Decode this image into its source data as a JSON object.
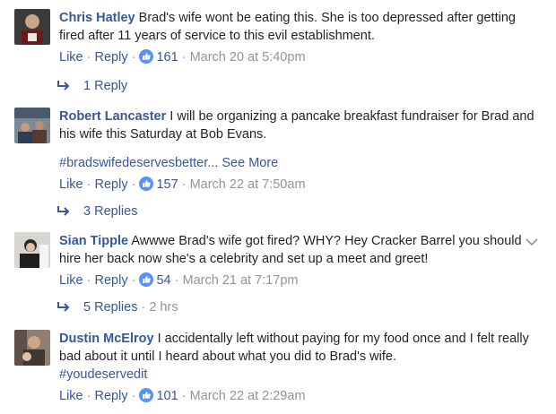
{
  "comments": [
    {
      "name": "Chris Hatley",
      "text": "Brad's wife wont be eating this. She is too depressed after getting fired after 11 years of service to this evil establishment.",
      "hashtag": "",
      "like_label": "Like",
      "reply_label": "Reply",
      "reactions": "161",
      "time": "March 20 at 5:40pm",
      "replies": "1 Reply",
      "replies_age": ""
    },
    {
      "name": "Robert Lancaster",
      "text": "I will be organizing a pancake breakfast fundraiser for Brad and his wife this Saturday at Bob Evans.",
      "hashtag": "#bradswifedeservesbetter...",
      "see_more": "See More",
      "like_label": "Like",
      "reply_label": "Reply",
      "reactions": "157",
      "time": "March 22 at 7:50am",
      "replies": "3 Replies",
      "replies_age": ""
    },
    {
      "name": "Sian Tipple",
      "text": "Awwwe Brad's wife got fired? WHY? Hey Cracker Barrel you should hire her back now she's a celebrity and set up a meet and greet!",
      "hashtag": "",
      "like_label": "Like",
      "reply_label": "Reply",
      "reactions": "54",
      "time": "March 21 at 7:17pm",
      "replies": "5 Replies",
      "replies_age": "2 hrs"
    },
    {
      "name": "Dustin McElroy",
      "text": "I accidentally left without paying for my food once and I felt really bad about it until I heard about what you did to Brad's wife.",
      "hashtag": "#youdeservedit",
      "like_label": "Like",
      "reply_label": "Reply",
      "reactions": "101",
      "time": "March 22 at 2:29am",
      "replies": "",
      "replies_age": ""
    }
  ],
  "icons": {
    "like": "thumbs-up-icon",
    "reply_arrow": "reply-arrow-icon",
    "options": "chevron-down-icon"
  },
  "colors": {
    "link": "#365899",
    "meta": "#90949c",
    "like_badge": "#5890ff"
  }
}
